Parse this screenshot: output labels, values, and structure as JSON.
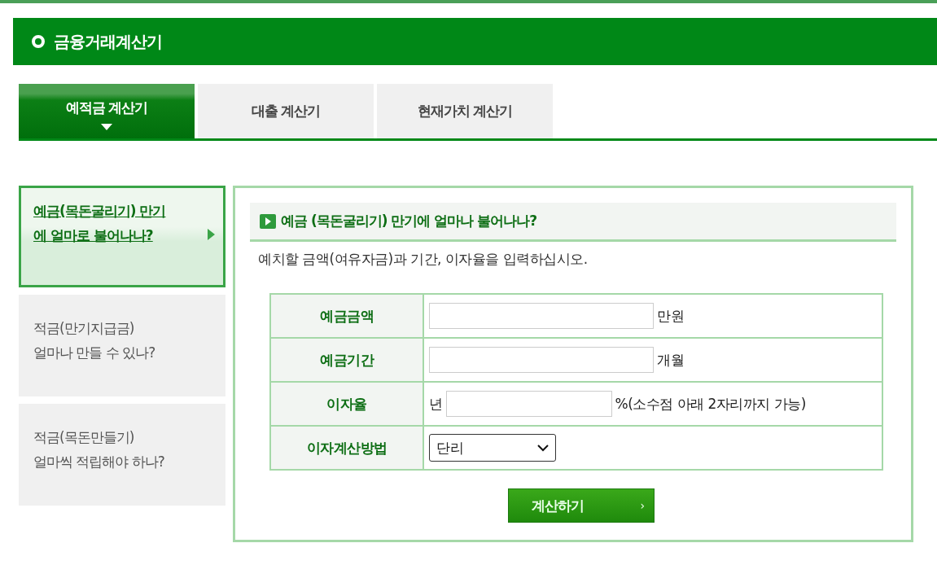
{
  "header": {
    "title": "금융거래계산기"
  },
  "tabs": [
    {
      "label": "예적금 계산기",
      "selected": true
    },
    {
      "label": "대출 계산기",
      "selected": false
    },
    {
      "label": "현재가치 계산기",
      "selected": false
    }
  ],
  "sidebar": {
    "items": [
      {
        "lines": [
          "예금(목돈굴리기) 만기",
          "에 얼마로 불어나나?"
        ],
        "selected": true
      },
      {
        "lines": [
          "적금(만기지급금)",
          "얼마나 만들 수 있나?"
        ],
        "selected": false
      },
      {
        "lines": [
          "적금(목돈만들기)",
          "얼마씩 적립해야 하나?"
        ],
        "selected": false
      }
    ]
  },
  "form": {
    "title": "예금 (목돈굴리기) 만기에 얼마나 불어나나?",
    "instruction": "예치할 금액(여유자금)과 기간, 이자율을 입력하십시오.",
    "fields": [
      {
        "kind": "text",
        "label": "예금금액",
        "suffix": "만원"
      },
      {
        "kind": "text",
        "label": "예금기간",
        "suffix": "개월"
      },
      {
        "kind": "text",
        "label": "이자율",
        "prefix": "년",
        "suffix": "%(소수점 아래 2자리까지 가능)"
      },
      {
        "kind": "select",
        "label": "이자계산방법",
        "value": "단리"
      }
    ],
    "submit": {
      "label": "계산하기",
      "arrow": "›"
    }
  }
}
